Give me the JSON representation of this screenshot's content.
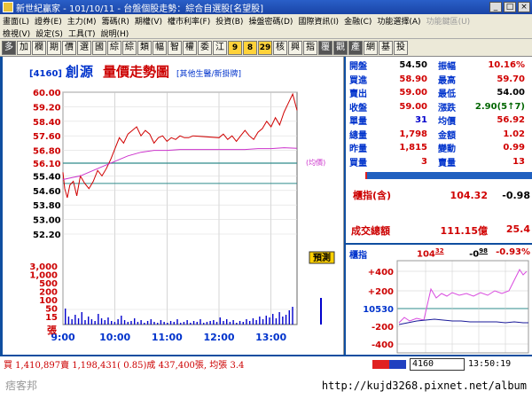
{
  "window": {
    "title": "新世紀贏家 - 101/10/11 - 台盤個股走勢：綜合自選股[名望股]",
    "buttons": [
      "_",
      "□",
      "×"
    ]
  },
  "menus": {
    "row1": [
      {
        "label": "畫面(L)",
        "enabled": true
      },
      {
        "label": "證券(E)",
        "enabled": true
      },
      {
        "label": "主力(M)",
        "enabled": true
      },
      {
        "label": "籌碼(R)",
        "enabled": true
      },
      {
        "label": "期權(V)",
        "enabled": true
      },
      {
        "label": "權市利率(F)",
        "enabled": true
      },
      {
        "label": "投資(B)",
        "enabled": true
      },
      {
        "label": "操盤密碼(D)",
        "enabled": true
      },
      {
        "label": "國際資訊(I)",
        "enabled": true
      },
      {
        "label": "金融(C)",
        "enabled": true
      },
      {
        "label": "功能選擇(A)",
        "enabled": true
      },
      {
        "label": "功能鍵區(U)",
        "enabled": false
      }
    ],
    "row2": [
      {
        "label": "檢視(V)",
        "enabled": true
      },
      {
        "label": "設定(S)",
        "enabled": true
      },
      {
        "label": "工具(T)",
        "enabled": true
      },
      {
        "label": "說明(H)",
        "enabled": true
      }
    ]
  },
  "toolbar": [
    "多",
    "加",
    "欄",
    "期",
    "價",
    "選",
    "國",
    "綜",
    "綜",
    "類",
    "幅",
    "智",
    "權",
    "委",
    "江",
    "9",
    "8",
    "29",
    "核",
    "興",
    "指",
    "覆",
    "觀",
    "產",
    "網",
    "基",
    "投"
  ],
  "chart": {
    "code": "[4160]",
    "stock_name": "創源",
    "title": "量價走勢圖",
    "links": "[其他生醫/新掛牌]",
    "avg_label": "(均價)",
    "pre_label": "預測"
  },
  "chart_data": {
    "type": "line",
    "price_axis": {
      "ticks": [
        "60.00",
        "59.20",
        "58.40",
        "57.60",
        "56.80",
        "56.10",
        "55.40",
        "54.60",
        "53.80",
        "53.00",
        "52.20"
      ],
      "ylim": [
        52.2,
        60.0
      ]
    },
    "volume_axis": {
      "ticks": [
        "3,000",
        "1,000",
        "500",
        "200",
        "100",
        "50",
        "15"
      ],
      "unit": "張"
    },
    "time_axis": [
      "9:00",
      "10:00",
      "11:00",
      "12:00",
      "13:00"
    ],
    "reference_price": 54.0,
    "series": [
      {
        "name": "成交價",
        "color": "#d00000",
        "x": [
          "9:00",
          "9:02",
          "9:05",
          "9:08",
          "9:12",
          "9:16",
          "9:20",
          "9:25",
          "9:30",
          "9:35",
          "9:40",
          "9:45",
          "9:50",
          "9:55",
          "10:00",
          "10:05",
          "10:10",
          "10:15",
          "10:20",
          "10:25",
          "10:30",
          "10:35",
          "10:40",
          "10:45",
          "10:50",
          "10:55",
          "11:00",
          "11:05",
          "11:10",
          "11:15",
          "11:20",
          "11:25",
          "11:30",
          "12:00",
          "12:05",
          "12:10",
          "12:15",
          "12:20",
          "12:25",
          "12:30",
          "12:35",
          "12:40",
          "12:45",
          "12:50",
          "12:55",
          "13:00",
          "13:05",
          "13:10",
          "13:15",
          "13:20",
          "13:25",
          "13:30"
        ],
        "values": [
          55.6,
          54.7,
          54.2,
          54.9,
          55.1,
          54.3,
          55.4,
          55.0,
          54.7,
          55.1,
          55.7,
          55.4,
          55.8,
          56.3,
          56.9,
          57.5,
          57.2,
          57.7,
          57.9,
          58.1,
          57.6,
          57.9,
          57.7,
          57.2,
          57.5,
          57.6,
          57.3,
          57.5,
          57.4,
          57.6,
          57.5,
          57.5,
          57.6,
          57.5,
          57.7,
          57.4,
          57.6,
          57.3,
          57.6,
          57.9,
          57.6,
          57.4,
          57.8,
          58.0,
          58.4,
          58.1,
          58.6,
          58.2,
          58.9,
          59.4,
          59.9,
          59.0
        ]
      },
      {
        "name": "均價",
        "color": "#cc33cc",
        "x": [
          "9:00",
          "9:10",
          "9:20",
          "9:30",
          "9:45",
          "10:00",
          "10:15",
          "10:30",
          "10:45",
          "11:00",
          "11:15",
          "11:30",
          "12:00",
          "12:15",
          "12:30",
          "12:45",
          "13:00",
          "13:15",
          "13:30"
        ],
        "values": [
          55.2,
          55.3,
          55.4,
          55.6,
          55.9,
          56.2,
          56.5,
          56.7,
          56.8,
          56.8,
          56.85,
          56.85,
          56.85,
          56.85,
          56.85,
          56.9,
          56.9,
          56.95,
          56.92
        ]
      }
    ]
  },
  "quote": {
    "rows": [
      {
        "l1": "開盤",
        "v1": "54.50",
        "c1": "black",
        "l2": "振幅",
        "v2": "10.16%",
        "c2": "red"
      },
      {
        "l1": "買進",
        "v1": "58.90",
        "c1": "red",
        "l2": "最高",
        "v2": "59.70",
        "c2": "red"
      },
      {
        "l1": "賣出",
        "v1": "59.00",
        "c1": "red",
        "l2": "最低",
        "v2": "54.00",
        "c2": "black"
      },
      {
        "l1": "收盤",
        "v1": "59.00",
        "c1": "red",
        "l2": "漲跌",
        "v2": "2.90(5↑7)",
        "c2": "green"
      },
      {
        "l1": "單量",
        "v1": "31",
        "c1": "blue",
        "l2": "均價",
        "v2": "56.92",
        "c2": "red"
      },
      {
        "l1": "總量",
        "v1": "1,798",
        "c1": "red",
        "l2": "金額",
        "v2": "1.02",
        "c2": "red"
      },
      {
        "l1": "昨量",
        "v1": "1,815",
        "c1": "red",
        "l2": "變動",
        "v2": "0.99",
        "c2": "red"
      },
      {
        "l1": "買量",
        "v1": "3",
        "c1": "red",
        "l2": "賣量",
        "v2": "13",
        "c2": "red"
      }
    ]
  },
  "index": {
    "label": "櫃指(含)",
    "value": "104.32",
    "change": "-0.98"
  },
  "turnover": {
    "label": "成交總額",
    "value": "111.15億",
    "change": "25.4"
  },
  "mini_chart": {
    "label": "櫃指",
    "value": "104",
    "value_dec": "32",
    "change": "-0",
    "change_dec": "98",
    "pct": "-0.93%",
    "ticks": [
      "+400",
      "+200",
      "10530",
      "-200",
      "-400"
    ]
  },
  "status": {
    "text": "買 1,410,897賣 1,198,431( 0.85)成 437,400張, 均張 3.4",
    "code": "4160",
    "time": "13:50:19"
  },
  "watermark": {
    "logo": "痞客邦",
    "url": "http://kujd3268.pixnet.net/album"
  }
}
